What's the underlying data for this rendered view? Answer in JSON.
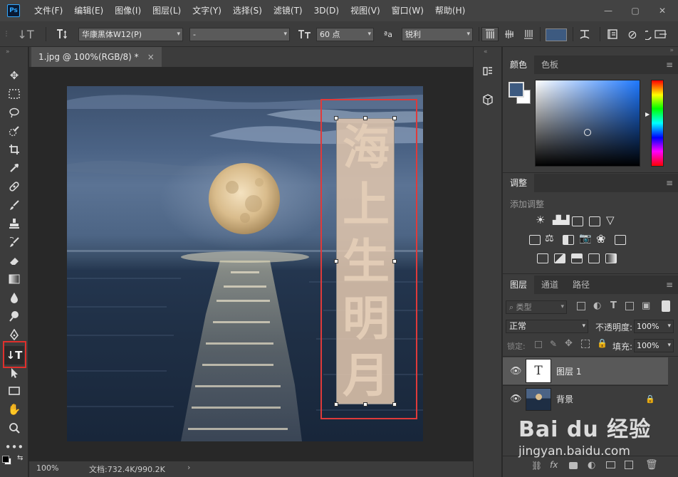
{
  "app": {
    "logo": "Ps"
  },
  "menu": [
    "文件(F)",
    "编辑(E)",
    "图像(I)",
    "图层(L)",
    "文字(Y)",
    "选择(S)",
    "滤镜(T)",
    "3D(D)",
    "视图(V)",
    "窗口(W)",
    "帮助(H)"
  ],
  "window_controls": {
    "minimize": "—",
    "restore": "▢",
    "close": "✕"
  },
  "options": {
    "tool_glyph": "↓T",
    "font_family": "华康黑体W12(P)",
    "font_style": "-",
    "font_size": "60 点",
    "aa_label": "ªa",
    "antialias": "锐利",
    "text_color": "#3d5a80"
  },
  "document": {
    "tab": "1.jpg @ 100%(RGB/8) *",
    "close": "×"
  },
  "canvas_text": [
    "海",
    "上",
    "生",
    "明",
    "月"
  ],
  "status": {
    "zoom": "100%",
    "doc_info": "文档:732.4K/990.2K",
    "arrow": "›"
  },
  "panels": {
    "color": {
      "tabs": [
        "颜色",
        "色板"
      ],
      "fg": "#3d5a80",
      "bg": "#ffffff"
    },
    "adjustments": {
      "title": "调整",
      "add_label": "添加调整"
    },
    "layers": {
      "tabs": [
        "图层",
        "通道",
        "路径"
      ],
      "filter_label": "类型",
      "blend_mode": "正常",
      "opacity_label": "不透明度:",
      "opacity": "100%",
      "lock_label": "锁定:",
      "fill_label": "填充:",
      "fill": "100%",
      "items": [
        {
          "name": "图层 1",
          "thumb": "T",
          "selected": true
        },
        {
          "name": "背景",
          "thumb": "",
          "selected": false
        }
      ]
    }
  },
  "watermark": {
    "text": "Bai du 经验",
    "url": "jingyan.baidu.com"
  }
}
